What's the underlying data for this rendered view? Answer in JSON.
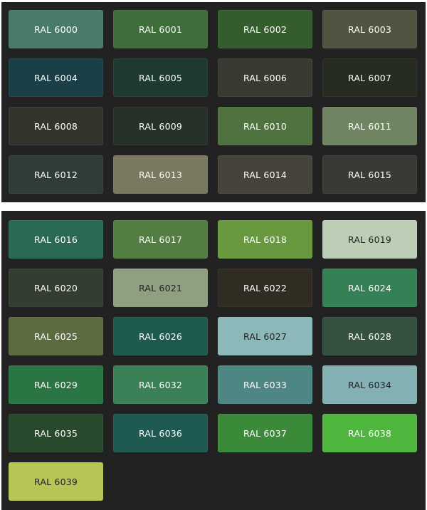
{
  "groups": [
    {
      "swatches": [
        {
          "label": "RAL 6000",
          "color": "#4a7a6a",
          "text": "#ffffff"
        },
        {
          "label": "RAL 6001",
          "color": "#3f6e3a",
          "text": "#ffffff"
        },
        {
          "label": "RAL 6002",
          "color": "#355c2d",
          "text": "#ffffff"
        },
        {
          "label": "RAL 6003",
          "color": "#4f5540",
          "text": "#ffffff"
        },
        {
          "label": "RAL 6004",
          "color": "#1b3f47",
          "text": "#ffffff"
        },
        {
          "label": "RAL 6005",
          "color": "#1f3b30",
          "text": "#ffffff"
        },
        {
          "label": "RAL 6006",
          "color": "#3a3a33",
          "text": "#ffffff"
        },
        {
          "label": "RAL 6007",
          "color": "#272c22",
          "text": "#ffffff"
        },
        {
          "label": "RAL 6008",
          "color": "#35342c",
          "text": "#ffffff"
        },
        {
          "label": "RAL 6009",
          "color": "#26312a",
          "text": "#ffffff"
        },
        {
          "label": "RAL 6010",
          "color": "#4f7240",
          "text": "#ffffff"
        },
        {
          "label": "RAL 6011",
          "color": "#6e8462",
          "text": "#ffffff"
        },
        {
          "label": "RAL 6012",
          "color": "#2f3c38",
          "text": "#ffffff"
        },
        {
          "label": "RAL 6013",
          "color": "#7a7860",
          "text": "#ffffff"
        },
        {
          "label": "RAL 6014",
          "color": "#45433a",
          "text": "#ffffff"
        },
        {
          "label": "RAL 6015",
          "color": "#383b35",
          "text": "#ffffff"
        }
      ]
    },
    {
      "swatches": [
        {
          "label": "RAL 6016",
          "color": "#2a6a52",
          "text": "#ffffff"
        },
        {
          "label": "RAL 6017",
          "color": "#537e42",
          "text": "#ffffff"
        },
        {
          "label": "RAL 6018",
          "color": "#69993f",
          "text": "#ffffff"
        },
        {
          "label": "RAL 6019",
          "color": "#bccfb6",
          "text": "#222222"
        },
        {
          "label": "RAL 6020",
          "color": "#333d30",
          "text": "#ffffff"
        },
        {
          "label": "RAL 6021",
          "color": "#8ea080",
          "text": "#222222"
        },
        {
          "label": "RAL 6022",
          "color": "#312c22",
          "text": "#ffffff"
        },
        {
          "label": "RAL 6024",
          "color": "#338155",
          "text": "#ffffff"
        },
        {
          "label": "RAL 6025",
          "color": "#5c6c3f",
          "text": "#ffffff"
        },
        {
          "label": "RAL 6026",
          "color": "#1e5a4e",
          "text": "#ffffff"
        },
        {
          "label": "RAL 6027",
          "color": "#8bb9b9",
          "text": "#222222"
        },
        {
          "label": "RAL 6028",
          "color": "#35513f",
          "text": "#ffffff"
        },
        {
          "label": "RAL 6029",
          "color": "#2b7544",
          "text": "#ffffff"
        },
        {
          "label": "RAL 6032",
          "color": "#3a8158",
          "text": "#ffffff"
        },
        {
          "label": "RAL 6033",
          "color": "#4e8683",
          "text": "#ffffff"
        },
        {
          "label": "RAL 6034",
          "color": "#82b0b3",
          "text": "#222222"
        },
        {
          "label": "RAL 6035",
          "color": "#284a2c",
          "text": "#ffffff"
        },
        {
          "label": "RAL 6036",
          "color": "#1e5a52",
          "text": "#ffffff"
        },
        {
          "label": "RAL 6037",
          "color": "#3b8a3a",
          "text": "#ffffff"
        },
        {
          "label": "RAL 6038",
          "color": "#4fb63d",
          "text": "#ffffff"
        },
        {
          "label": "RAL 6039",
          "color": "#b6c554",
          "text": "#222222"
        }
      ]
    }
  ]
}
